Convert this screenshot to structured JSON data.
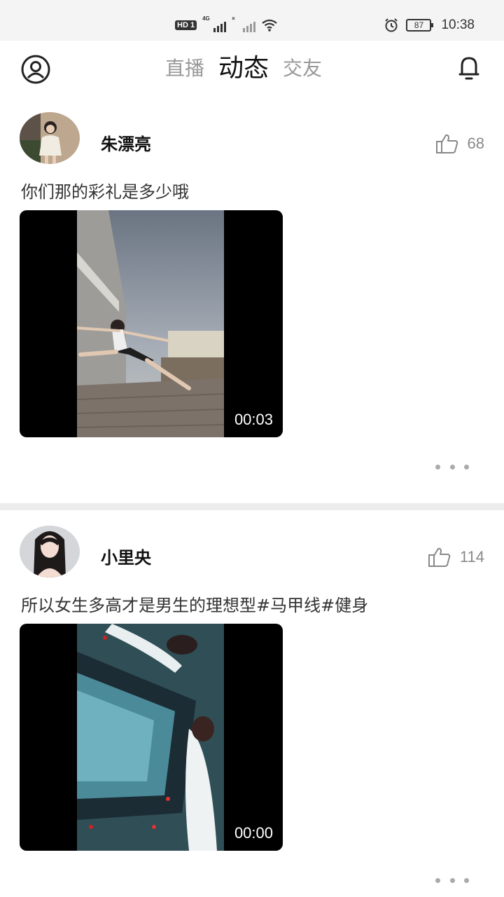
{
  "status_bar": {
    "hd_label": "HD",
    "hd_sim": "1",
    "network_type": "4G",
    "battery": "87",
    "time": "10:38"
  },
  "header": {
    "tabs": [
      {
        "label": "直播",
        "active": false
      },
      {
        "label": "动态",
        "active": true
      },
      {
        "label": "交友",
        "active": false
      }
    ]
  },
  "posts": [
    {
      "username": "朱漂亮",
      "likes": "68",
      "text": "你们那的彩礼是多少哦",
      "video_duration": "00:03"
    },
    {
      "username": "小里央",
      "likes": "114",
      "text": "所以女生多高才是男生的理想型#马甲线#健身",
      "video_duration": "00:00"
    }
  ],
  "colors": {
    "accent": "#e73a5c",
    "tab_inactive": "#999999",
    "separator": "#ececec"
  },
  "icons": [
    "profile-icon",
    "bell-icon",
    "thumbs-up-icon",
    "more-icon",
    "alarm-icon",
    "wifi-icon"
  ]
}
